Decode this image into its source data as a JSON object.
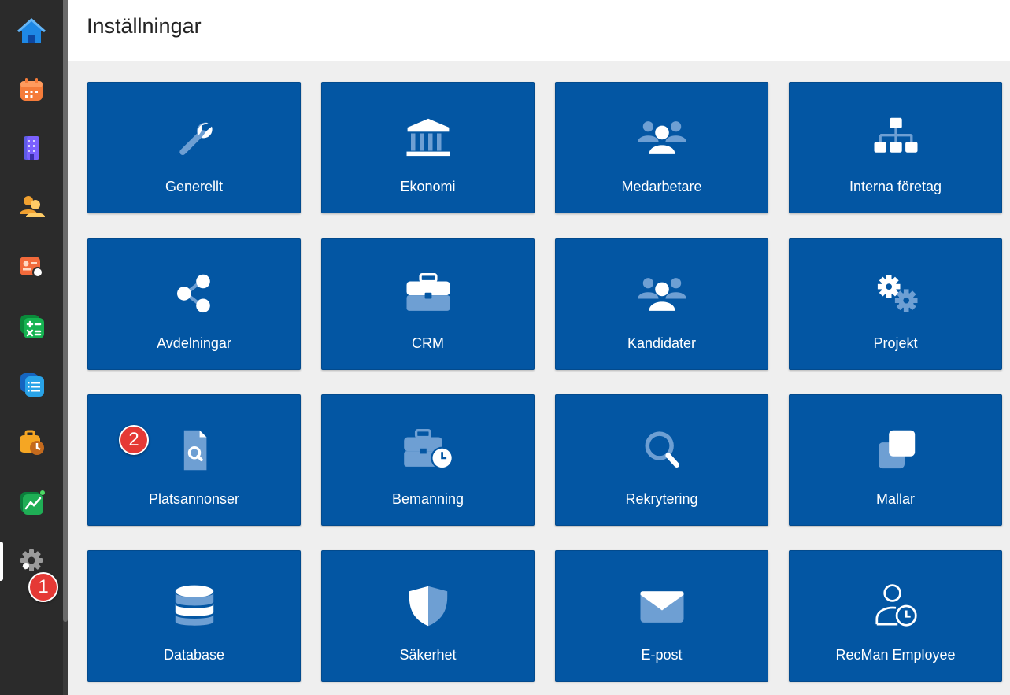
{
  "page": {
    "title": "Inställningar"
  },
  "sidebar": {
    "items": [
      {
        "id": "home",
        "icon": "house-icon"
      },
      {
        "id": "calendar",
        "icon": "calendar-icon"
      },
      {
        "id": "companies",
        "icon": "building-icon"
      },
      {
        "id": "contacts",
        "icon": "people-icon"
      },
      {
        "id": "candidate-search",
        "icon": "person-search-icon"
      },
      {
        "id": "calculator",
        "icon": "calculator-icon"
      },
      {
        "id": "documents",
        "icon": "document-list-icon"
      },
      {
        "id": "timesheet",
        "icon": "briefcase-clock-icon"
      },
      {
        "id": "statistics",
        "icon": "chart-line-icon"
      },
      {
        "id": "settings",
        "icon": "gear-icon",
        "active": true
      }
    ]
  },
  "tiles": [
    {
      "label": "Generellt",
      "icon": "wrench-icon"
    },
    {
      "label": "Ekonomi",
      "icon": "bank-icon"
    },
    {
      "label": "Medarbetare",
      "icon": "users-icon"
    },
    {
      "label": "Interna företag",
      "icon": "org-chart-icon"
    },
    {
      "label": "Avdelningar",
      "icon": "share-nodes-icon"
    },
    {
      "label": "CRM",
      "icon": "briefcase-icon"
    },
    {
      "label": "Kandidater",
      "icon": "users-icon"
    },
    {
      "label": "Projekt",
      "icon": "gears-icon"
    },
    {
      "label": "Platsannonser",
      "icon": "file-search-icon"
    },
    {
      "label": "Bemanning",
      "icon": "briefcase-clock-icon"
    },
    {
      "label": "Rekrytering",
      "icon": "magnifier-icon"
    },
    {
      "label": "Mallar",
      "icon": "clone-icon"
    },
    {
      "label": "Database",
      "icon": "database-icon"
    },
    {
      "label": "Säkerhet",
      "icon": "shield-icon"
    },
    {
      "label": "E-post",
      "icon": "envelope-icon"
    },
    {
      "label": "RecMan Employee",
      "icon": "user-clock-icon"
    }
  ],
  "annotations": [
    {
      "label": "1",
      "color": "#e53935"
    },
    {
      "label": "2",
      "color": "#e53935"
    }
  ],
  "colors": {
    "tile": "#0356a3",
    "sidebar": "#2b2b2b",
    "background": "#efefef"
  }
}
